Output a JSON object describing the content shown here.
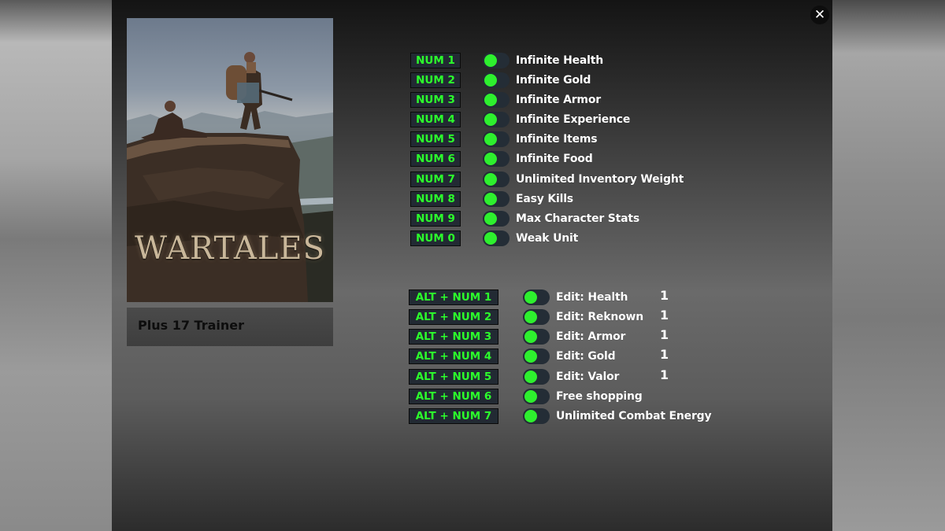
{
  "window": {
    "close_icon": "close-icon"
  },
  "game": {
    "cover_title": "WARTALES",
    "trainer_label": "Plus 17 Trainer"
  },
  "cheats": [
    {
      "key": "NUM 1",
      "label": "Infinite Health",
      "enabled": true
    },
    {
      "key": "NUM 2",
      "label": "Infinite Gold",
      "enabled": true
    },
    {
      "key": "NUM 3",
      "label": "Infinite Armor",
      "enabled": true
    },
    {
      "key": "NUM 4",
      "label": "Infinite Experience",
      "enabled": true
    },
    {
      "key": "NUM 5",
      "label": "Infinite Items",
      "enabled": true
    },
    {
      "key": "NUM 6",
      "label": "Infinite Food",
      "enabled": true
    },
    {
      "key": "NUM 7",
      "label": "Unlimited Inventory Weight",
      "enabled": true
    },
    {
      "key": "NUM 8",
      "label": "Easy Kills",
      "enabled": true
    },
    {
      "key": "NUM 9",
      "label": "Max Character Stats",
      "enabled": true
    },
    {
      "key": "NUM 0",
      "label": "Weak Unit",
      "enabled": true
    }
  ],
  "alt_cheats": [
    {
      "key": "ALT + NUM 1",
      "label": "Edit: Health",
      "value": "1",
      "enabled": true
    },
    {
      "key": "ALT + NUM 2",
      "label": "Edit: Reknown",
      "value": "1",
      "enabled": true
    },
    {
      "key": "ALT + NUM 3",
      "label": "Edit: Armor",
      "value": "1",
      "enabled": true
    },
    {
      "key": "ALT + NUM 4",
      "label": "Edit: Gold",
      "value": "1",
      "enabled": true
    },
    {
      "key": "ALT + NUM 5",
      "label": "Edit: Valor",
      "value": "1",
      "enabled": true
    },
    {
      "key": "ALT + NUM 6",
      "label": "Free shopping",
      "value": null,
      "enabled": true
    },
    {
      "key": "ALT + NUM 7",
      "label": "Unlimited Combat Energy",
      "value": null,
      "enabled": true
    }
  ],
  "colors": {
    "hotkey_text": "#2cff2c",
    "toggle_on": "#2ef02e",
    "hotkey_bg": "#222a33"
  }
}
